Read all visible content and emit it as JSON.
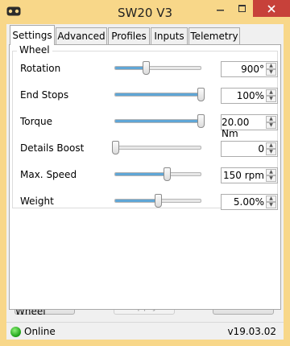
{
  "window": {
    "title": "SW20 V3"
  },
  "tabs": [
    {
      "label": "Settings",
      "active": true
    },
    {
      "label": "Advanced",
      "active": false
    },
    {
      "label": "Profiles",
      "active": false
    },
    {
      "label": "Inputs",
      "active": false
    },
    {
      "label": "Telemetry",
      "active": false
    }
  ],
  "wheel": {
    "group_title": "Wheel",
    "rows": [
      {
        "label": "Rotation",
        "value": "900°",
        "slider_level": 0.36
      },
      {
        "label": "End Stops",
        "value": "100%",
        "slider_level": 1.0
      },
      {
        "label": "Torque",
        "value": "20.00 Nm",
        "slider_level": 1.0
      },
      {
        "label": "Details Boost",
        "value": "0",
        "slider_level": 0.0
      },
      {
        "label": "Max. Speed",
        "value": "150 rpm",
        "slider_level": 0.6
      },
      {
        "label": "Weight",
        "value": "5.00%",
        "slider_level": 0.5
      }
    ]
  },
  "buttons": {
    "center_wheel": "Center Wheel",
    "apply": "Apply",
    "close": "Close"
  },
  "status": {
    "text": "Online",
    "version": "v19.03.02"
  },
  "colors": {
    "titlebar": "#f8d789",
    "close_button": "#c7413a",
    "slider_fill": "#5fa6d6",
    "status_online": "#22a61a"
  },
  "icons": {
    "app": "app-logo-icon",
    "minimize": "minimize-icon",
    "maximize": "maximize-icon",
    "close": "close-icon",
    "spin_up": "spin-up-icon",
    "spin_down": "spin-down-icon",
    "status": "online-status-icon"
  }
}
